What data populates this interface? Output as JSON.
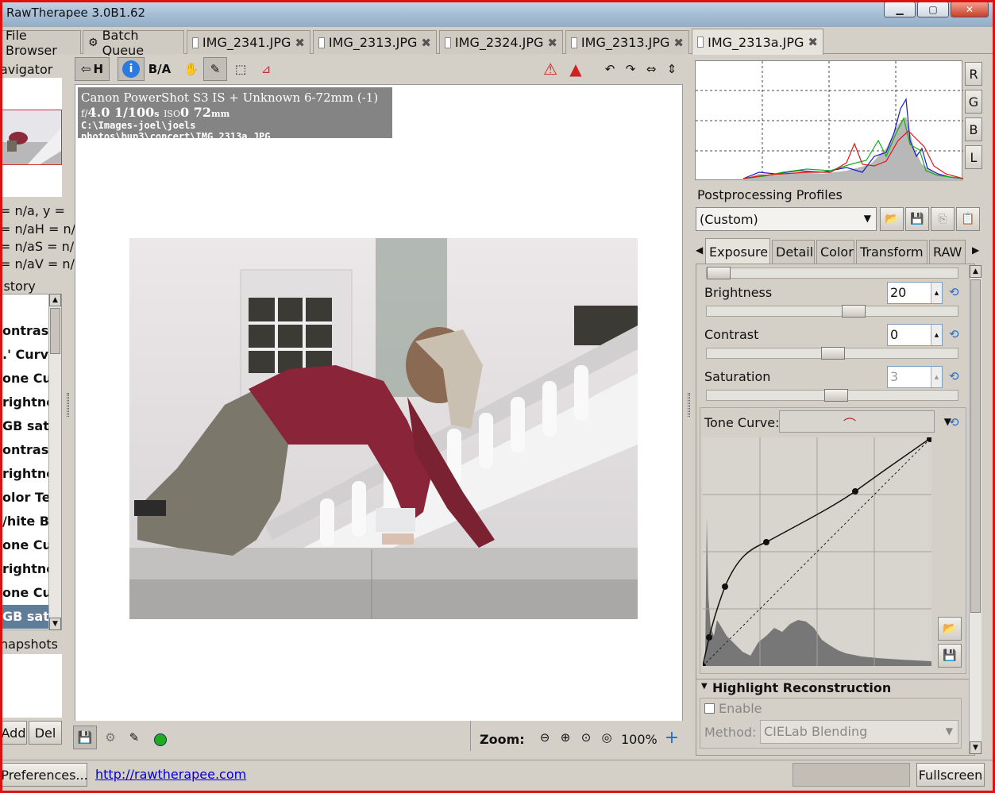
{
  "window": {
    "title": "RawTherapee 3.0B1.62",
    "controls": [
      "minimize",
      "maximize",
      "close"
    ]
  },
  "tabs": [
    {
      "label": "File Browser",
      "icon": "none",
      "closable": false,
      "active": false
    },
    {
      "label": "Batch Queue",
      "icon": "gear-icon",
      "closable": false,
      "active": false
    },
    {
      "label": "IMG_2341.JPG",
      "icon": "file-icon",
      "closable": true,
      "active": false
    },
    {
      "label": "IMG_2313.JPG",
      "icon": "file-icon",
      "closable": true,
      "active": false
    },
    {
      "label": "IMG_2324.JPG",
      "icon": "file-icon",
      "closable": true,
      "active": false
    },
    {
      "label": "IMG_2313.JPG",
      "icon": "file-icon",
      "closable": true,
      "active": false
    },
    {
      "label": "IMG_2313a.JPG",
      "icon": "file-icon",
      "closable": true,
      "active": true
    }
  ],
  "left_panel": {
    "navigator_title": "avigator",
    "coords": [
      "= n/a, y =",
      "= n/aH = n/",
      "= n/aS = n/",
      "= n/aV = n/"
    ],
    "history_title": "istory",
    "history_items": [
      {
        "label": "ontrast",
        "selected": false
      },
      {
        "label": ".' Curve",
        "selected": false
      },
      {
        "label": "one Cu",
        "selected": false
      },
      {
        "label": "rightne",
        "selected": false
      },
      {
        "label": "GB sat",
        "selected": false
      },
      {
        "label": "ontrast",
        "selected": false
      },
      {
        "label": "rightne",
        "selected": false
      },
      {
        "label": "olor Te",
        "selected": false
      },
      {
        "label": "/hite B",
        "selected": false
      },
      {
        "label": "one Cu",
        "selected": false
      },
      {
        "label": "rightne",
        "selected": false
      },
      {
        "label": "one Cu",
        "selected": false
      },
      {
        "label": "GB sat",
        "selected": true
      }
    ],
    "snapshots_title": "napshots",
    "add_label": "Add",
    "del_label": "Del"
  },
  "toolbar": {
    "hide_label": "H",
    "ba_label": "B/A"
  },
  "preview": {
    "info_line1": "Canon PowerShot S3 IS + Unknown 6-72mm (-1)",
    "info_aperture_prefix": "f/",
    "info_aperture": "4.0",
    "info_shutter": "1/100",
    "info_shutter_unit": "s",
    "info_iso_label": "ISO",
    "info_iso": "0",
    "info_focal": "72",
    "info_focal_unit": "mm",
    "info_path": "C:\\Images-joel\\joels photos\\bup3\\concert\\IMG_2313a.JPG"
  },
  "bottom_bar": {
    "zoom_label": "Zoom:",
    "zoom_value": "100%",
    "status_color": "#22aa22"
  },
  "right_panel": {
    "histogram_buttons": [
      "R",
      "G",
      "B",
      "L"
    ],
    "profiles_title": "Postprocessing Profiles",
    "profile_value": "(Custom)",
    "tool_tabs": [
      {
        "label": "Exposure",
        "active": true
      },
      {
        "label": "Detail",
        "active": false
      },
      {
        "label": "Color",
        "active": false
      },
      {
        "label": "Transform",
        "active": false
      },
      {
        "label": "RAW",
        "active": false
      }
    ],
    "brightness_label": "Brightness",
    "brightness_value": "20",
    "contrast_label": "Contrast",
    "contrast_value": "0",
    "saturation_label": "Saturation",
    "saturation_value": "3",
    "tone_curve_label": "Tone Curve:",
    "highlight_title": "Highlight Reconstruction",
    "enable_label": "Enable",
    "method_label": "Method:",
    "method_value": "CIELab Blending"
  },
  "statusbar": {
    "preferences_label": "Preferences...",
    "url": "http://rawtherapee.com",
    "fullscreen_label": "Fullscreen"
  },
  "colors": {
    "window_border": "#e01010",
    "accent_blue": "#2a6bc0",
    "history_selected": "#5f7d99"
  }
}
